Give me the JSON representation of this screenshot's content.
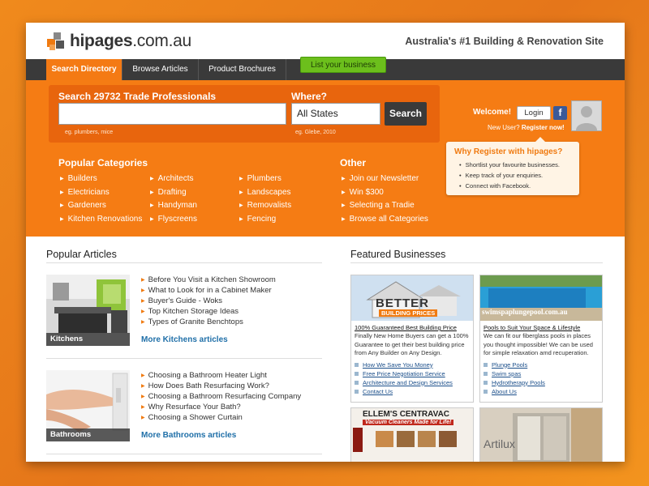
{
  "logo": {
    "brand": "hipages",
    "domain": ".com.au"
  },
  "tagline": "Australia's #1 Building & Renovation Site",
  "nav": {
    "tabs": [
      "Search Directory",
      "Browse Articles",
      "Product Brochures"
    ],
    "list_business": "List your business"
  },
  "search": {
    "title": "Search 29732 Trade Professionals",
    "input_value": "",
    "input_hint": "eg. plumbers, mice",
    "where_label": "Where?",
    "state_value": "All States",
    "where_hint": "eg. Glebe, 2010",
    "button": "Search"
  },
  "categories": {
    "title": "Popular Categories",
    "columns": [
      [
        "Builders",
        "Electricians",
        "Gardeners",
        "Kitchen Renovations"
      ],
      [
        "Architects",
        "Drafting",
        "Handyman",
        "Flyscreens"
      ],
      [
        "Plumbers",
        "Landscapes",
        "Removalists",
        "Fencing"
      ]
    ]
  },
  "other": {
    "title": "Other",
    "items": [
      "Join our Newsletter",
      "Win $300",
      "Selecting a Tradie",
      "Browse all Categories"
    ]
  },
  "account": {
    "welcome": "Welcome!",
    "login": "Login",
    "facebook": "f",
    "new_user": "New User?",
    "register": "Register now!"
  },
  "why_register": {
    "title": "Why Register with hipages?",
    "items": [
      "Shortlist your favourite businesses.",
      "Keep track of your enquiries.",
      "Connect with Facebook."
    ]
  },
  "popular_articles": {
    "title": "Popular Articles",
    "groups": [
      {
        "caption": "Kitchens",
        "links": [
          "Before You Visit a Kitchen Showroom",
          "What to Look for in a Cabinet Maker",
          "Buyer's Guide - Woks",
          "Top Kitchen Storage Ideas",
          "Types of Granite Benchtops"
        ],
        "more": "More Kitchens articles"
      },
      {
        "caption": "Bathrooms",
        "links": [
          "Choosing a Bathroom Heater Light",
          "How Does Bath Resurfacing Work?",
          "Choosing a Bathroom Resurfacing Company",
          "Why Resurface Your Bath?",
          "Choosing a Shower Curtain"
        ],
        "more": "More Bathrooms articles"
      }
    ]
  },
  "featured": {
    "title": "Featured Businesses",
    "cards": [
      {
        "logo_line1": "BETTER",
        "logo_line2": "BUILDING PRICES",
        "headline": "100% Guaranteed Best Building Price",
        "desc": "Finally New Home Buyers can get a 100% Guarantee to get their best building price from Any Builder on Any Design.",
        "links": [
          "How We Save You Money",
          "Free Price Negotiation Service",
          "Architecture and Design Services",
          "Contact Us"
        ]
      },
      {
        "banner": "swimspaplungepool.com.au",
        "headline": "Pools to Suit Your Space & Lifestyle",
        "desc": "We can fit our fiberglass pools in places you thought impossible! We can be used for simple relaxation amd recuperation.",
        "links": [
          "Plunge Pools",
          "Swim spas",
          "Hydrotherapy Pools",
          "About Us"
        ]
      },
      {
        "title": "ELLEM'S CENTRAVAC",
        "subtitle": "Vacuum Cleaners Made for Life!"
      },
      {
        "brand": "Artilux"
      }
    ]
  },
  "colors": {
    "accent": "#f57c14",
    "nav": "#3a3a3a",
    "link": "#1f6fa8",
    "green": "#6cbf1c"
  }
}
